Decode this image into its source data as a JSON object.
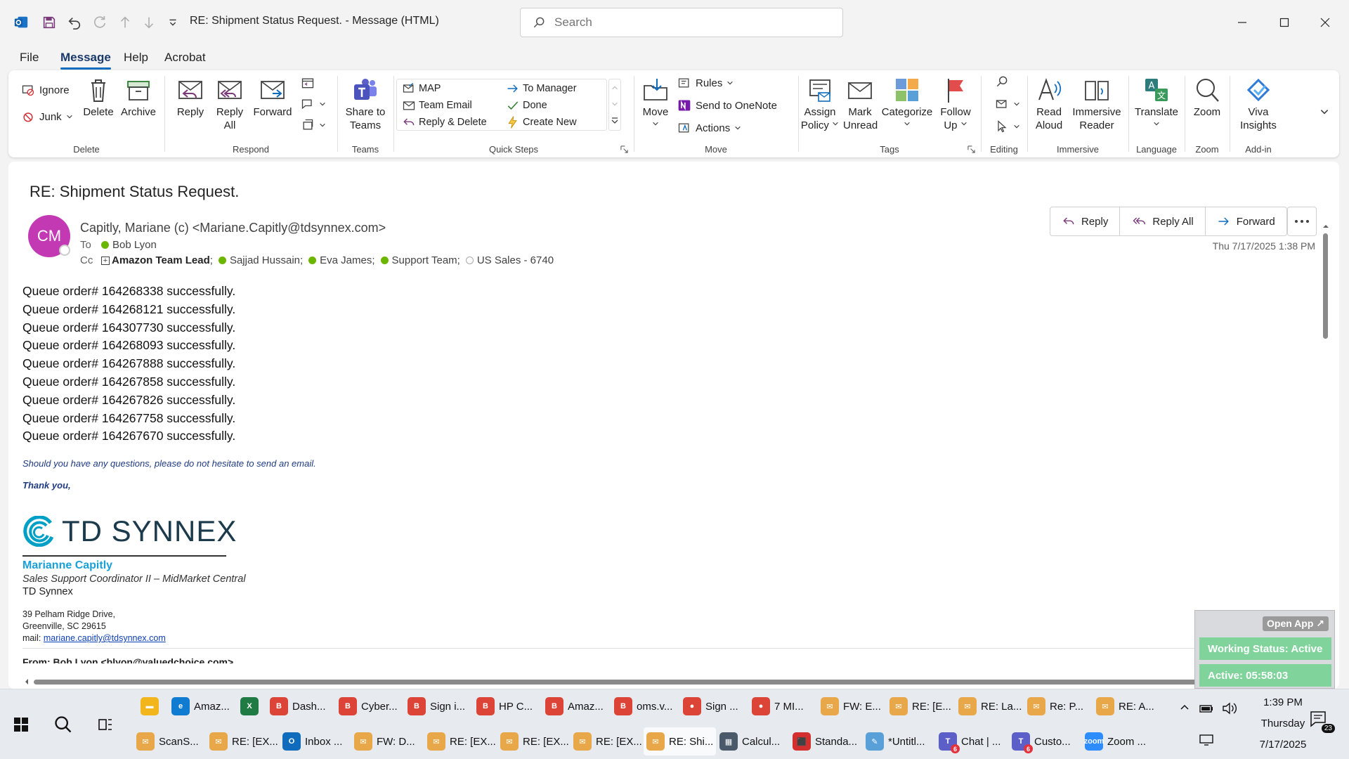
{
  "window": {
    "title": "RE: Shipment Status Request.  -  Message (HTML)",
    "search_placeholder": "Search"
  },
  "menu": [
    "File",
    "Message",
    "Help",
    "Acrobat"
  ],
  "ribbon": {
    "delete": {
      "label": "Delete",
      "ignore": "Ignore",
      "junk": "Junk",
      "delete": "Delete",
      "archive": "Archive"
    },
    "respond": {
      "label": "Respond",
      "reply": "Reply",
      "reply_all_1": "Reply",
      "reply_all_2": "All",
      "forward": "Forward"
    },
    "teams": {
      "label": "Teams",
      "share_1": "Share to",
      "share_2": "Teams"
    },
    "quick_steps": {
      "label": "Quick Steps",
      "items": [
        "MAP",
        "Team Email",
        "Reply & Delete",
        "To Manager",
        "Done",
        "Create New"
      ]
    },
    "move": {
      "label": "Move",
      "move": "Move",
      "rules": "Rules",
      "onenote": "Send to OneNote",
      "actions": "Actions"
    },
    "tags": {
      "label": "Tags",
      "assign_1": "Assign",
      "assign_2": "Policy",
      "mark_1": "Mark",
      "mark_2": "Unread",
      "categorize": "Categorize",
      "follow_1": "Follow",
      "follow_2": "Up"
    },
    "editing": {
      "label": "Editing"
    },
    "immersive": {
      "label": "Immersive",
      "read_1": "Read",
      "read_2": "Aloud",
      "imm_1": "Immersive",
      "imm_2": "Reader"
    },
    "language": {
      "label": "Language",
      "translate": "Translate"
    },
    "zoom": {
      "label": "Zoom",
      "zoom": "Zoom"
    },
    "addin": {
      "label": "Add-in",
      "viva_1": "Viva",
      "viva_2": "Insights"
    }
  },
  "message": {
    "subject": "RE: Shipment Status Request.",
    "avatar_initials": "CM",
    "sender": "Capitly, Mariane (c) <Mariane.Capitly@tdsynnex.com>",
    "to_label": "To",
    "to": [
      "Bob Lyon"
    ],
    "cc_label": "Cc",
    "cc": [
      {
        "name": "Amazon Team Lead",
        "group": true
      },
      {
        "name": "Sajjad Hussain;",
        "status": "online"
      },
      {
        "name": "Eva James;",
        "status": "online"
      },
      {
        "name": "Support Team;",
        "status": "online"
      },
      {
        "name": "US Sales - 6740",
        "status": "offline"
      }
    ],
    "date": "Thu 7/17/2025 1:38 PM",
    "actions": {
      "reply": "Reply",
      "reply_all": "Reply All",
      "forward": "Forward"
    },
    "body_lines": [
      "Queue order# 164268338 successfully.",
      "Queue order# 164268121 successfully.",
      "Queue order# 164307730 successfully.",
      "Queue order# 164268093 successfully.",
      "Queue order# 164267888 successfully.",
      "Queue order# 164267858 successfully.",
      "Queue order# 164267826 successfully.",
      "Queue order# 164267758 successfully.",
      "Queue order# 164267670 successfully."
    ],
    "closing_1": "Should you have any questions, please do not hesitate to send an email.",
    "closing_2": "Thank you,",
    "signature": {
      "logo_text": "TD SYNNEX",
      "name": "Marianne Capitly",
      "title": "Sales Support Coordinator II – MidMarket Central",
      "company": "TD Synnex",
      "address_1": "39 Pelham Ridge Drive,",
      "address_2": "Greenville, SC 29615",
      "mail_label": "mail:",
      "mail": "mariane.capitly@tdsynnex.com"
    },
    "next_header": "From: Bob Lyon <blyon@valuedchoice.com>"
  },
  "popup": {
    "open_app": "Open App ↗",
    "status": "Working Status: Active",
    "timer": "Active: 05:58:03"
  },
  "taskbar": {
    "row1": [
      {
        "label": "",
        "color": "#f2b61c",
        "glyph": "▬",
        "name": "file-explorer"
      },
      {
        "label": "Amaz...",
        "color": "#0f7bd1",
        "glyph": "e",
        "name": "edge"
      },
      {
        "label": "",
        "color": "#1f7a44",
        "glyph": "X",
        "name": "excel"
      },
      {
        "label": "Dash...",
        "color": "#db4437",
        "glyph": "B",
        "name": "chrome-b"
      },
      {
        "label": "Cyber...",
        "color": "#db4437",
        "glyph": "B",
        "name": "chrome-b"
      },
      {
        "label": "Sign i...",
        "color": "#db4437",
        "glyph": "B",
        "name": "chrome-b"
      },
      {
        "label": "HP C...",
        "color": "#db4437",
        "glyph": "B",
        "name": "chrome-b"
      },
      {
        "label": "Amaz...",
        "color": "#db4437",
        "glyph": "B",
        "name": "chrome-b"
      },
      {
        "label": "oms.v...",
        "color": "#db4437",
        "glyph": "B",
        "name": "chrome-b"
      },
      {
        "label": "Sign ...",
        "color": "#db4437",
        "glyph": "●",
        "name": "chrome-c"
      },
      {
        "label": "7 MI...",
        "color": "#db4437",
        "glyph": "●",
        "name": "chrome-c"
      },
      {
        "label": "FW: E...",
        "color": "#e8a84a",
        "glyph": "✉",
        "name": "mail"
      },
      {
        "label": "RE: [E...",
        "color": "#e8a84a",
        "glyph": "✉",
        "name": "mail"
      },
      {
        "label": "RE: La...",
        "color": "#e8a84a",
        "glyph": "✉",
        "name": "mail"
      },
      {
        "label": "Re: P...",
        "color": "#e8a84a",
        "glyph": "✉",
        "name": "mail"
      },
      {
        "label": "RE: A...",
        "color": "#e8a84a",
        "glyph": "✉",
        "name": "mail"
      }
    ],
    "row2": [
      {
        "label": "ScanS...",
        "color": "#e8a84a",
        "glyph": "✉",
        "name": "mail"
      },
      {
        "label": "RE: [EX...",
        "color": "#e8a84a",
        "glyph": "✉",
        "name": "mail"
      },
      {
        "label": "Inbox ...",
        "color": "#0f6cbd",
        "glyph": "O",
        "name": "outlook"
      },
      {
        "label": "FW: D...",
        "color": "#e8a84a",
        "glyph": "✉",
        "name": "mail"
      },
      {
        "label": "RE: [EX...",
        "color": "#e8a84a",
        "glyph": "✉",
        "name": "mail"
      },
      {
        "label": "RE: [EX...",
        "color": "#e8a84a",
        "glyph": "✉",
        "name": "mail"
      },
      {
        "label": "RE: [EX...",
        "color": "#e8a84a",
        "glyph": "✉",
        "name": "mail"
      },
      {
        "label": "RE: Shi...",
        "color": "#e8a84a",
        "glyph": "✉",
        "name": "mail",
        "selected": true
      },
      {
        "label": "Calcul...",
        "color": "#4a5a6a",
        "glyph": "▦",
        "name": "calculator"
      },
      {
        "label": "Standa...",
        "color": "#d32f2f",
        "glyph": "⬛",
        "name": "pdf"
      },
      {
        "label": "*Untitl...",
        "color": "#5aa0d8",
        "glyph": "✎",
        "name": "paint"
      },
      {
        "label": "Chat | ...",
        "color": "#5b5fc7",
        "glyph": "T",
        "name": "teams",
        "badge": "6"
      },
      {
        "label": "Custo...",
        "color": "#5b5fc7",
        "glyph": "T",
        "name": "teams",
        "badge": "6"
      },
      {
        "label": "Zoom ...",
        "color": "#2d8cff",
        "glyph": "zoom",
        "name": "zoom"
      }
    ],
    "time": "1:39 PM",
    "day": "Thursday",
    "date": "7/17/2025",
    "notification_count": "23"
  }
}
